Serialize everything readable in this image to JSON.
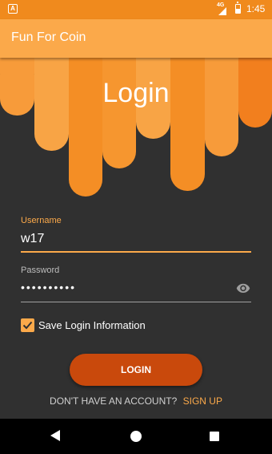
{
  "status_bar": {
    "time": "1:45",
    "network": "4G",
    "app_icon": "A"
  },
  "app_bar": {
    "title": "Fun For Coin"
  },
  "header": {
    "title": "Login"
  },
  "form": {
    "username_label": "Username",
    "username_value": "w17",
    "password_label": "Password",
    "password_value": "••••••••••",
    "remember_label": "Save Login Information",
    "remember_checked": true
  },
  "login_button": {
    "label": "LOGIN"
  },
  "signup": {
    "prompt": "DON'T HAVE AN ACCOUNT?",
    "link": "SIGN UP"
  },
  "icons": {
    "status": [
      "app-notification-icon",
      "signal-icon",
      "battery-icon"
    ],
    "password_toggle": "eye-icon",
    "nav": [
      "back-icon",
      "home-icon",
      "recents-icon"
    ]
  },
  "colors": {
    "primary": "#FBA94A",
    "status_bar": "#F08A1D",
    "background": "#303030",
    "button": "#C9490C",
    "accent_text": "#FBA94A"
  }
}
